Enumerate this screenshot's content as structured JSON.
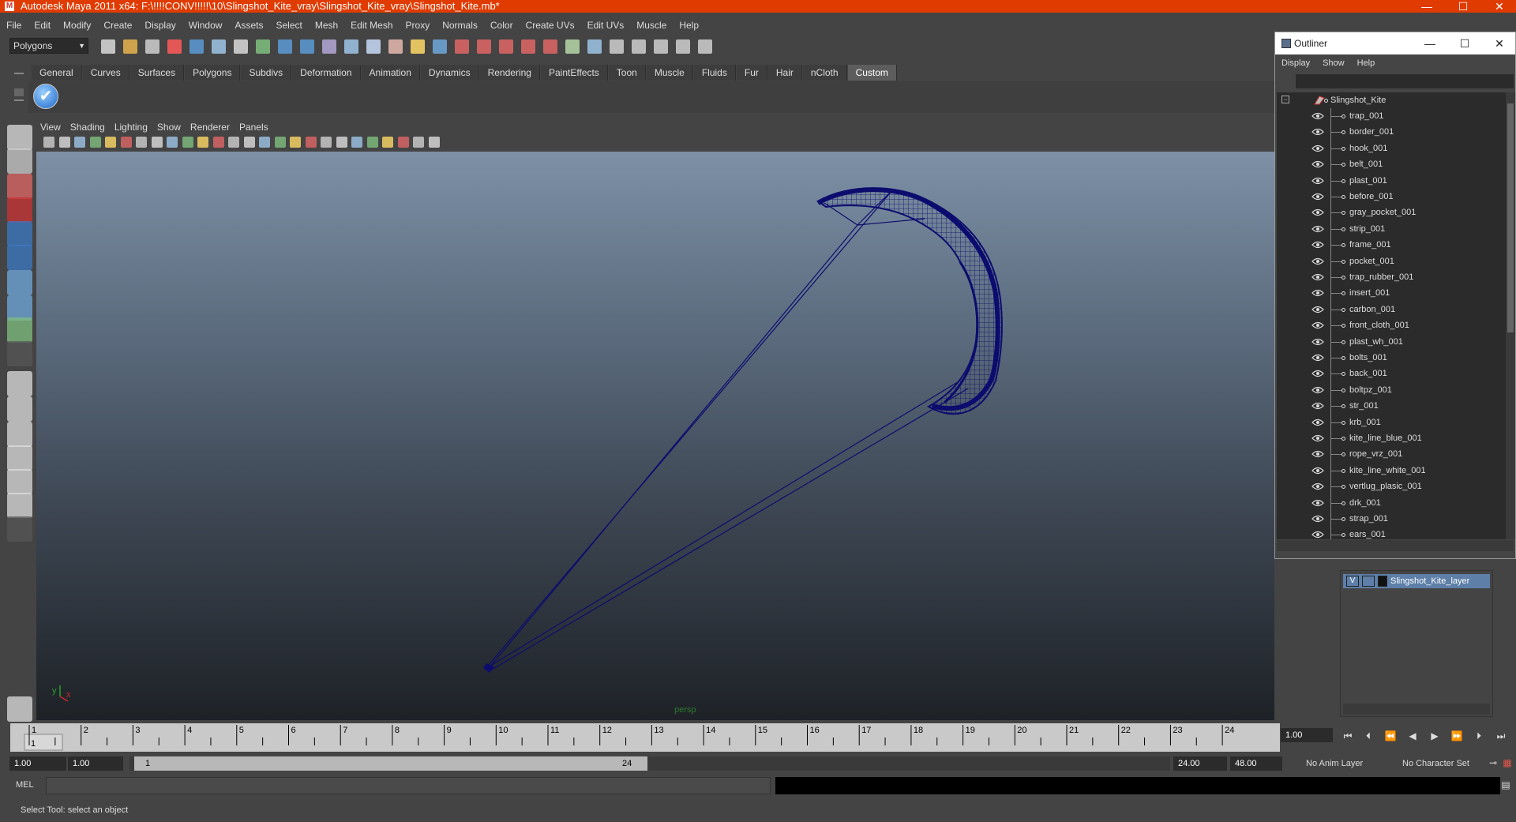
{
  "window": {
    "title": "Autodesk Maya 2011 x64: F:\\!!!!CONV!!!!!\\10\\Slingshot_Kite_vray\\Slingshot_Kite_vray\\Slingshot_Kite.mb*",
    "minimize": "—",
    "maximize": "☐",
    "close": "✕"
  },
  "menubar": [
    "File",
    "Edit",
    "Modify",
    "Create",
    "Display",
    "Window",
    "Assets",
    "Select",
    "Mesh",
    "Edit Mesh",
    "Proxy",
    "Normals",
    "Color",
    "Create UVs",
    "Edit UVs",
    "Muscle",
    "Help"
  ],
  "statusline": {
    "mode": "Polygons"
  },
  "shelf": {
    "tabs": [
      "General",
      "Curves",
      "Surfaces",
      "Polygons",
      "Subdivs",
      "Deformation",
      "Animation",
      "Dynamics",
      "Rendering",
      "PaintEffects",
      "Toon",
      "Muscle",
      "Fluids",
      "Fur",
      "Hair",
      "nCloth",
      "Custom"
    ],
    "active_tab": "Custom"
  },
  "panel": {
    "menus": [
      "View",
      "Shading",
      "Lighting",
      "Show",
      "Renderer",
      "Panels"
    ],
    "camera": "persp",
    "axis_y": "y",
    "axis_x": "x"
  },
  "timeline": {
    "start": 1,
    "end": 24,
    "current": "1",
    "current_frame_field": "1.00"
  },
  "range": {
    "start_time": "1.00",
    "playback_start": "1.00",
    "range_start_label": "1",
    "range_end_label": "24",
    "playback_end": "24.00",
    "end_time": "48.00",
    "anim_layer": "No Anim Layer",
    "character_set": "No Character Set"
  },
  "commandline": {
    "label": "MEL"
  },
  "helpline": {
    "text": "Select Tool: select an object"
  },
  "outliner": {
    "title": "Outliner",
    "menus": [
      "Display",
      "Show",
      "Help"
    ],
    "root": "Slingshot_Kite",
    "items": [
      "trap_001",
      "border_001",
      "hook_001",
      "belt_001",
      "plast_001",
      "before_001",
      "gray_pocket_001",
      "strip_001",
      "frame_001",
      "pocket_001",
      "trap_rubber_001",
      "insert_001",
      "carbon_001",
      "front_cloth_001",
      "plast_wh_001",
      "bolts_001",
      "back_001",
      "boltpz_001",
      "str_001",
      "krb_001",
      "kite_line_blue_001",
      "rope_vrz_001",
      "kite_line_white_001",
      "vertlug_plasic_001",
      "drk_001",
      "strap_001",
      "ears_001"
    ]
  },
  "layers": {
    "visible": "V",
    "name": "Slingshot_Kite_layer"
  },
  "colors": {
    "title_bar": "#e03b00",
    "kite_wire": "#0c0c6e",
    "timeline": "#c9c9c9",
    "layer_selected": "#5d7fa8"
  }
}
